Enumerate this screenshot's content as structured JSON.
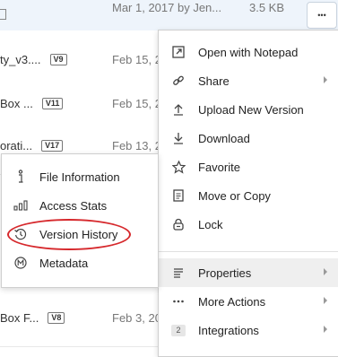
{
  "rows": [
    {
      "name": "",
      "badge": "",
      "date": "Mar 1, 2017 by Jen...",
      "size": "3.5 KB"
    },
    {
      "name": "ty_v3....",
      "badge": "V9",
      "date": "Feb 15, 2",
      "size": ""
    },
    {
      "name": "Box ...",
      "badge": "V11",
      "date": "Feb 15, 2",
      "size": ""
    },
    {
      "name": "orati...",
      "badge": "V17",
      "date": "Feb 13, 2",
      "size": ""
    },
    {
      "name": "Box F...",
      "badge": "V8",
      "date": "Feb 3, 20",
      "size": ""
    }
  ],
  "more_button_label": "•••",
  "menu": {
    "items": [
      {
        "label": "Open with Notepad",
        "icon": "open-external-icon"
      },
      {
        "label": "Share",
        "icon": "link-icon"
      },
      {
        "label": "Upload New Version",
        "icon": "upload-icon"
      },
      {
        "label": "Download",
        "icon": "download-icon"
      },
      {
        "label": "Favorite",
        "icon": "star-icon"
      },
      {
        "label": "Move or Copy",
        "icon": "move-copy-icon"
      },
      {
        "label": "Lock",
        "icon": "lock-icon"
      },
      {
        "label": "Properties",
        "icon": "properties-icon"
      },
      {
        "label": "More Actions",
        "icon": "ellipsis-icon"
      },
      {
        "label": "Integrations",
        "icon": "integrations-badge",
        "badge": "2"
      }
    ]
  },
  "submenu": {
    "items": [
      {
        "label": "File Information",
        "icon": "info-icon"
      },
      {
        "label": "Access Stats",
        "icon": "bar-chart-icon"
      },
      {
        "label": "Version History",
        "icon": "history-icon"
      },
      {
        "label": "Metadata",
        "icon": "metadata-icon"
      }
    ]
  },
  "colors": {
    "highlight_row": "#eef4fb",
    "annotation": "#d6282c",
    "active_item": "#efefef"
  }
}
